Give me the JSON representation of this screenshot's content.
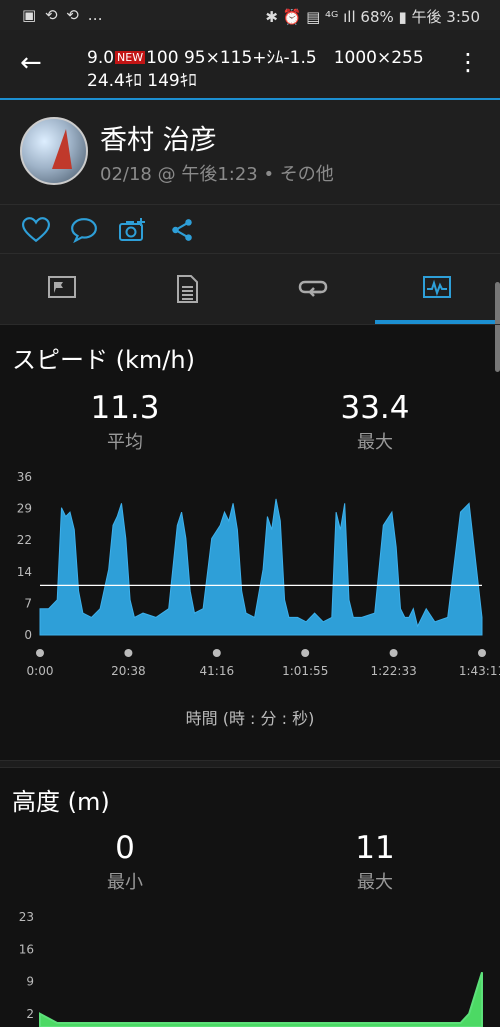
{
  "status_bar": {
    "left_icons": "▣ ⟲ ⟲ …",
    "right": "✱ ⏰ ▤ ⁴ᴳ ıll 68% ▮ 午後 3:50"
  },
  "app_bar": {
    "line1_a": "9.0",
    "badge": "NEW",
    "line1_b": "100 95×115+ｼﾑ-1.5　1000×255",
    "line2": "24.4ｷﾛ 149ｷﾛ"
  },
  "profile": {
    "name": "香村 治彦",
    "meta": "02/18 @ 午後1:23 • その他"
  },
  "accent": "#1c8fd1",
  "speed": {
    "title": "スピード (km/h)",
    "avg_value": "11.3",
    "avg_label": "平均",
    "max_value": "33.4",
    "max_label": "最大",
    "axis_note": "時間 (時 : 分 : 秒)"
  },
  "altitude": {
    "title": "高度 (m)",
    "min_value": "0",
    "min_label": "最小",
    "max_value": "11",
    "max_label": "最大"
  },
  "chart_data": [
    {
      "type": "area",
      "title": "スピード (km/h)",
      "ylim": [
        0,
        36
      ],
      "y_ticks": [
        "0",
        "7",
        "14",
        "22",
        "29",
        "36"
      ],
      "x_ticks": [
        "0:00",
        "20:38",
        "41:16",
        "1:01:55",
        "1:22:33",
        "1:43:11"
      ],
      "x": [
        0,
        2,
        4,
        5,
        6,
        7,
        8,
        9,
        10,
        12,
        14,
        16,
        17,
        18,
        19,
        20,
        21,
        22,
        24,
        27,
        30,
        32,
        33,
        34,
        35,
        36,
        38,
        40,
        42,
        43,
        44,
        45,
        46,
        47,
        48,
        50,
        52,
        53,
        54,
        55,
        56,
        57,
        58,
        60,
        62,
        64,
        66,
        68,
        69,
        70,
        71,
        72,
        73,
        75,
        78,
        80,
        82,
        83,
        84,
        85,
        86,
        87,
        88,
        90,
        92,
        95,
        98,
        100,
        103
      ],
      "values": [
        6,
        6,
        8,
        29,
        27,
        28,
        24,
        10,
        5,
        4,
        6,
        15,
        25,
        27,
        30,
        22,
        8,
        4,
        5,
        4,
        6,
        25,
        28,
        22,
        10,
        5,
        6,
        22,
        25,
        28,
        26,
        30,
        24,
        10,
        5,
        4,
        15,
        27,
        24,
        31,
        26,
        8,
        4,
        4,
        3,
        5,
        3,
        4,
        28,
        24,
        30,
        8,
        4,
        4,
        5,
        25,
        28,
        20,
        6,
        4,
        4,
        6,
        2,
        6,
        3,
        4,
        28,
        30,
        4
      ],
      "reference_line": 11.3,
      "color": "#2e9fd8"
    },
    {
      "type": "area",
      "title": "高度 (m)",
      "ylim": [
        0,
        23
      ],
      "y_ticks": [
        "2",
        "9",
        "16",
        "23"
      ],
      "x": [
        0,
        2,
        4,
        10,
        30,
        50,
        70,
        90,
        98,
        100,
        102,
        103
      ],
      "values": [
        2,
        1,
        0,
        0,
        0,
        0,
        0,
        0,
        0,
        2,
        8,
        11
      ],
      "color": "#4cd964"
    }
  ]
}
